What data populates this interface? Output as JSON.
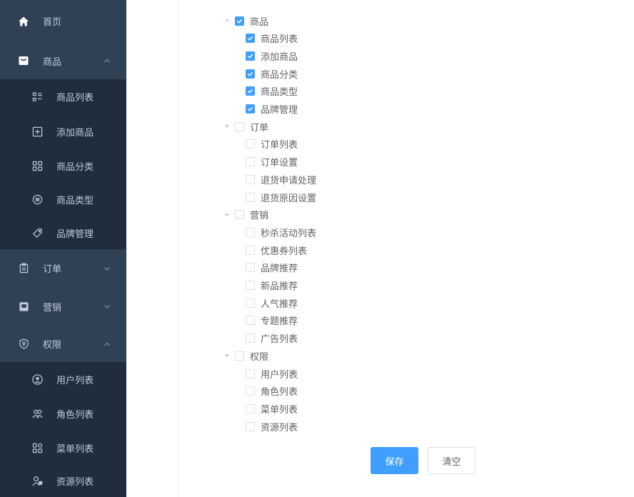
{
  "sidebar": {
    "items": [
      {
        "id": "home",
        "label": "首页",
        "icon": "home-icon",
        "level": "top",
        "arrow": ""
      },
      {
        "id": "product",
        "label": "商品",
        "icon": "product-icon",
        "level": "top",
        "arrow": "up"
      },
      {
        "id": "product-list",
        "label": "商品列表",
        "icon": "list-icon",
        "level": "sub",
        "arrow": ""
      },
      {
        "id": "add-product",
        "label": "添加商品",
        "icon": "add-icon",
        "level": "sub",
        "arrow": ""
      },
      {
        "id": "product-category",
        "label": "商品分类",
        "icon": "category-icon",
        "level": "sub",
        "arrow": ""
      },
      {
        "id": "product-type",
        "label": "商品类型",
        "icon": "type-icon",
        "level": "sub",
        "arrow": ""
      },
      {
        "id": "brand-manage",
        "label": "品牌管理",
        "icon": "tag-icon",
        "level": "sub",
        "arrow": ""
      },
      {
        "id": "order",
        "label": "订单",
        "icon": "order-icon",
        "level": "top",
        "arrow": "down"
      },
      {
        "id": "marketing",
        "label": "营销",
        "icon": "marketing-icon",
        "level": "top",
        "arrow": "down"
      },
      {
        "id": "permission",
        "label": "权限",
        "icon": "shield-icon",
        "level": "top",
        "arrow": "up"
      },
      {
        "id": "user-list",
        "label": "用户列表",
        "icon": "user-icon",
        "level": "sub",
        "arrow": ""
      },
      {
        "id": "role-list",
        "label": "角色列表",
        "icon": "role-icon",
        "level": "sub",
        "arrow": ""
      },
      {
        "id": "menu-list",
        "label": "菜单列表",
        "icon": "menu-icon",
        "level": "sub",
        "arrow": ""
      },
      {
        "id": "resource-list",
        "label": "资源列表",
        "icon": "resource-icon",
        "level": "sub",
        "arrow": ""
      }
    ]
  },
  "tree": {
    "nodes": [
      {
        "label": "商品",
        "level": 0,
        "checked": true
      },
      {
        "label": "商品列表",
        "level": 1,
        "checked": true
      },
      {
        "label": "添加商品",
        "level": 1,
        "checked": true
      },
      {
        "label": "商品分类",
        "level": 1,
        "checked": true
      },
      {
        "label": "商品类型",
        "level": 1,
        "checked": true
      },
      {
        "label": "品牌管理",
        "level": 1,
        "checked": true
      },
      {
        "label": "订单",
        "level": 0,
        "checked": false
      },
      {
        "label": "订单列表",
        "level": 1,
        "checked": false
      },
      {
        "label": "订单设置",
        "level": 1,
        "checked": false
      },
      {
        "label": "退货申请处理",
        "level": 1,
        "checked": false
      },
      {
        "label": "退货原因设置",
        "level": 1,
        "checked": false
      },
      {
        "label": "营销",
        "level": 0,
        "checked": false
      },
      {
        "label": "秒杀活动列表",
        "level": 1,
        "checked": false
      },
      {
        "label": "优惠券列表",
        "level": 1,
        "checked": false
      },
      {
        "label": "品牌推荐",
        "level": 1,
        "checked": false
      },
      {
        "label": "新品推荐",
        "level": 1,
        "checked": false
      },
      {
        "label": "人气推荐",
        "level": 1,
        "checked": false
      },
      {
        "label": "专题推荐",
        "level": 1,
        "checked": false
      },
      {
        "label": "广告列表",
        "level": 1,
        "checked": false
      },
      {
        "label": "权限",
        "level": 0,
        "checked": false
      },
      {
        "label": "用户列表",
        "level": 1,
        "checked": false
      },
      {
        "label": "角色列表",
        "level": 1,
        "checked": false
      },
      {
        "label": "菜单列表",
        "level": 1,
        "checked": false
      },
      {
        "label": "资源列表",
        "level": 1,
        "checked": false
      }
    ]
  },
  "actions": {
    "save_label": "保存",
    "clear_label": "清空"
  },
  "colors": {
    "sidebar_bg": "#304156",
    "sidebar_sub_bg": "#1f2d3d",
    "sidebar_text": "#bfcbd9",
    "primary": "#409eff"
  }
}
